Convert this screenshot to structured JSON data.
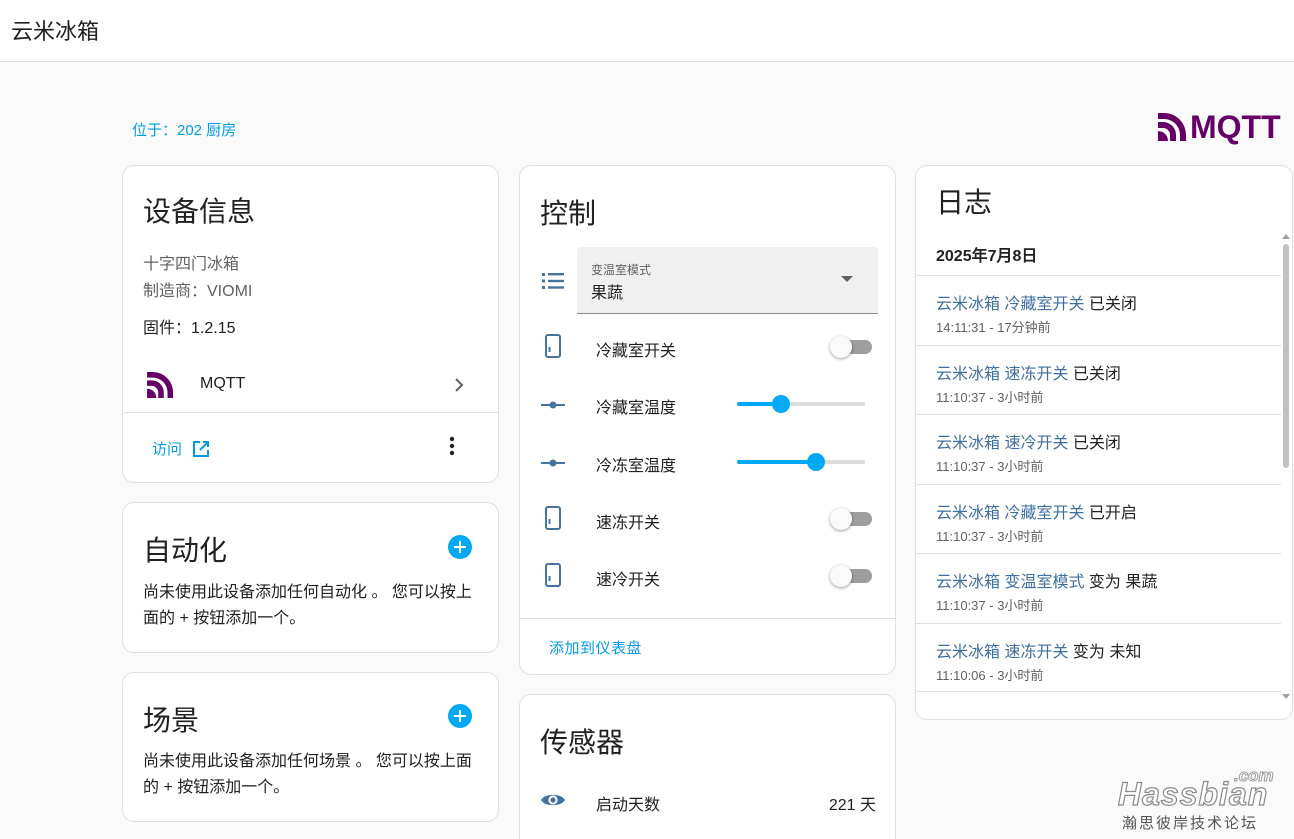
{
  "app": {
    "title": "云米冰箱"
  },
  "location": "位于：202 厨房",
  "brand_logo": {
    "text": "MQTT",
    "color": "#660066"
  },
  "device_info": {
    "title": "设备信息",
    "model": "十字四门冰箱",
    "manufacturer": "制造商：VIOMI",
    "firmware": "固件：1.2.15",
    "integration": "MQTT",
    "visit_label": "访问"
  },
  "automation": {
    "title": "自动化",
    "empty_text": "尚未使用此设备添加任何自动化 。 您可以按上面的 + 按钮添加一个。"
  },
  "scenes": {
    "title": "场景",
    "empty_text": "尚未使用此设备添加任何场景 。 您可以按上面的 + 按钮添加一个。"
  },
  "controls": {
    "title": "控制",
    "mode_select": {
      "label": "变温室模式",
      "value": "果蔬"
    },
    "rows": [
      {
        "type": "toggle",
        "label": "冷藏室开关",
        "on": false
      },
      {
        "type": "slider",
        "label": "冷藏室温度",
        "fraction": 0.34
      },
      {
        "type": "slider",
        "label": "冷冻室温度",
        "fraction": 0.62
      },
      {
        "type": "toggle",
        "label": "速冻开关",
        "on": false
      },
      {
        "type": "toggle",
        "label": "速冷开关",
        "on": false
      }
    ],
    "add_to_dashboard": "添加到仪表盘"
  },
  "sensors": {
    "title": "传感器",
    "rows": [
      {
        "label": "启动天数",
        "value": "221 天"
      }
    ]
  },
  "logbook": {
    "title": "日志",
    "date": "2025年7月8日",
    "entries": [
      {
        "entity": "云米冰箱 冷藏室开关",
        "action": " 已关闭",
        "time": "14:11:31 - 17分钟前"
      },
      {
        "entity": "云米冰箱 速冻开关",
        "action": " 已关闭",
        "time": "11:10:37 - 3小时前"
      },
      {
        "entity": "云米冰箱 速冷开关",
        "action": " 已关闭",
        "time": "11:10:37 - 3小时前"
      },
      {
        "entity": "云米冰箱 冷藏室开关",
        "action": " 已开启",
        "time": "11:10:37 - 3小时前"
      },
      {
        "entity": "云米冰箱 变温室模式",
        "action": " 变为 果蔬",
        "time": "11:10:37 - 3小时前"
      },
      {
        "entity": "云米冰箱 速冻开关",
        "action": " 变为 未知",
        "time": "11:10:06 - 3小时前"
      }
    ]
  },
  "watermark": {
    "main": "Hassbian",
    "com": ".com",
    "sub": "瀚思彼岸技术论坛"
  },
  "colors": {
    "accent": "#03a9f4",
    "link": "#039be5",
    "icon": "#44739e",
    "entity": "#3f6f9f"
  }
}
